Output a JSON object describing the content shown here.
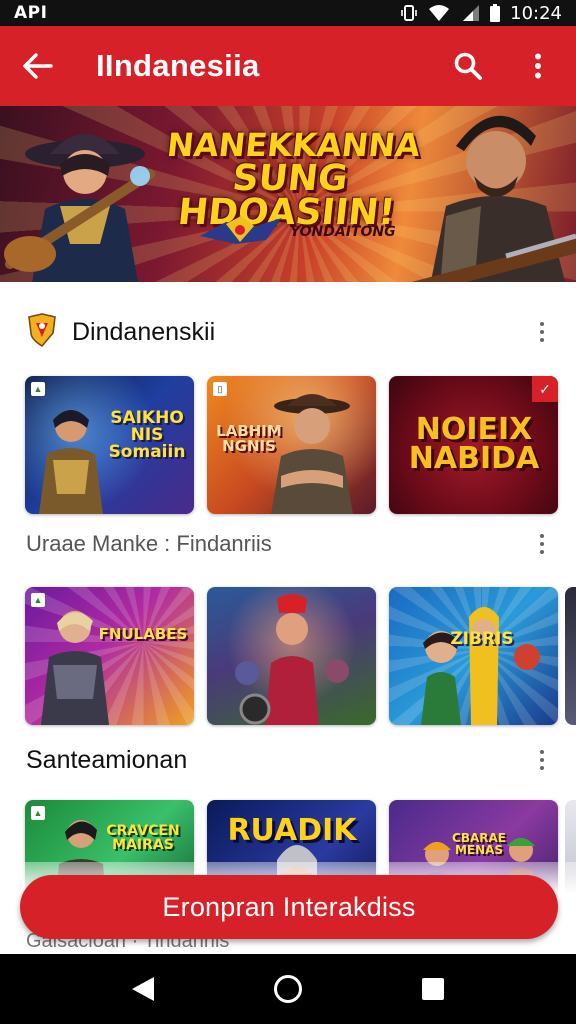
{
  "status_bar": {
    "carrier": "API",
    "time": "10:24"
  },
  "app_bar": {
    "title": "IIndanesiia",
    "color": "#d62128"
  },
  "banner": {
    "title_line1": "NANEKKANNA",
    "title_line2": "SUNG HDOASIIN!",
    "tagline": "YONDAITONG"
  },
  "sections": [
    {
      "title": "Dindanenskii",
      "cards": [
        {
          "label": "SAIKHO\nNIS\nSomaiin"
        },
        {
          "label": "LABHIM\nNGNIS"
        },
        {
          "label": "NOIEIX\nNABIDA"
        }
      ]
    },
    {
      "title": "Uraae Manke : Findanriis",
      "cards": [
        {
          "label": "FNULABES"
        },
        {
          "label": ""
        },
        {
          "label": "ZIBRIS"
        }
      ]
    },
    {
      "title": "Santeamionan",
      "cards": [
        {
          "label": "CRAVCEN\nMAIRAS"
        },
        {
          "label": "RUADIK"
        },
        {
          "label": "CBARAE\nMENAS"
        }
      ]
    }
  ],
  "cta": {
    "label": "Eronpran Interakdiss",
    "underneath_text": "Galsacioan    ·  Tindanriis"
  }
}
